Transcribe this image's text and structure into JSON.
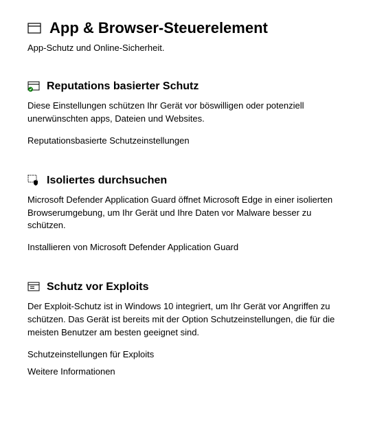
{
  "header": {
    "title": "App & Browser-Steuerelement",
    "subtitle": "App-Schutz und Online-Sicherheit."
  },
  "sections": {
    "reputation": {
      "title": "Reputations basierter Schutz",
      "desc": "Diese Einstellungen schützen Ihr Gerät vor böswilligen oder potenziell unerwünschten apps, Dateien und Websites.",
      "link": "Reputationsbasierte Schutzeinstellungen"
    },
    "isolated": {
      "title": "Isoliertes durchsuchen",
      "desc": "Microsoft Defender Application Guard öffnet Microsoft Edge in einer isolierten Browserumgebung, um Ihr Gerät und Ihre Daten vor Malware besser zu schützen.",
      "link": "Installieren von Microsoft Defender Application Guard"
    },
    "exploit": {
      "title": "Schutz vor Exploits",
      "desc": "Der Exploit-Schutz ist in Windows 10 integriert, um Ihr Gerät vor Angriffen zu schützen.             Das Gerät ist bereits mit der Option Schutzeinstellungen, die für die meisten Benutzer am besten geeignet sind.",
      "link1": "Schutzeinstellungen für Exploits",
      "link2": "Weitere Informationen"
    }
  }
}
